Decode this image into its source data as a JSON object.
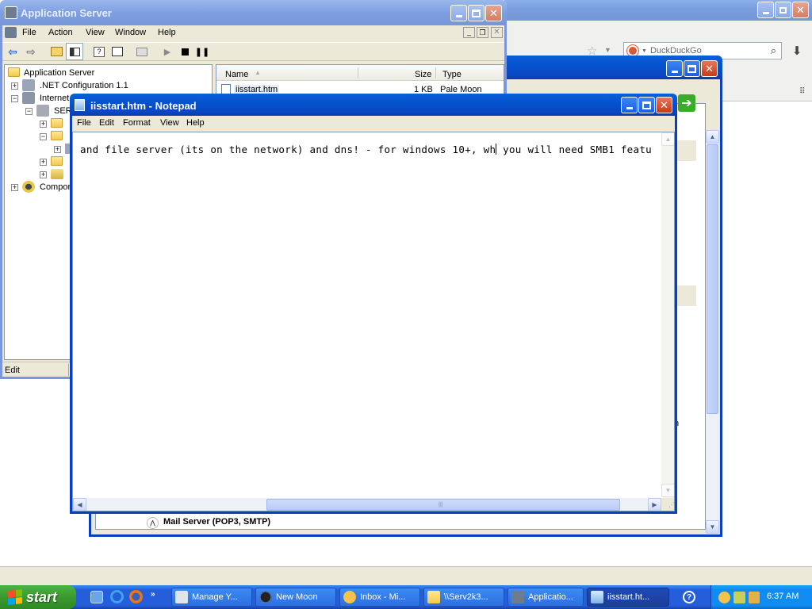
{
  "browser": {
    "search_value": "DuckDuckGo",
    "side_text_fragment": "n"
  },
  "app_server": {
    "title": "Application Server",
    "menu": [
      "File",
      "Action",
      "View",
      "Window",
      "Help"
    ],
    "tree": {
      "root": "Application Server",
      "net_config": ".NET Configuration 1.1",
      "iis": "Internet",
      "server": "SER",
      "components": "Compon"
    },
    "list_headers": {
      "name": "Name",
      "size": "Size",
      "type": "Type"
    },
    "list_row": {
      "name": "iisstart.htm",
      "size": "1 KB",
      "type": "Pale Moon HTML"
    },
    "status": "Edit"
  },
  "back_window": {
    "mail_server_label": "Mail Server (POP3, SMTP)"
  },
  "notepad": {
    "title": "iisstart.htm - Notepad",
    "menu": [
      "File",
      "Edit",
      "Format",
      "View",
      "Help"
    ],
    "content_before_cursor": "and file server (its on the network) and dns! - for windows 10+, wh",
    "content_after_cursor": " you will need SMB1 featu"
  },
  "taskbar": {
    "start_label": "start",
    "tasks": [
      "Manage Y...",
      "New Moon",
      "Inbox - Mi...",
      "\\\\Serv2k3...",
      "Applicatio...",
      "iisstart.ht..."
    ],
    "clock": "6:37 AM"
  },
  "colors": {
    "xp_title_blue": "#0453d0",
    "taskbar_blue": "#245edb",
    "start_green": "#3a9a2e",
    "tray_blue": "#0f8bf2"
  }
}
